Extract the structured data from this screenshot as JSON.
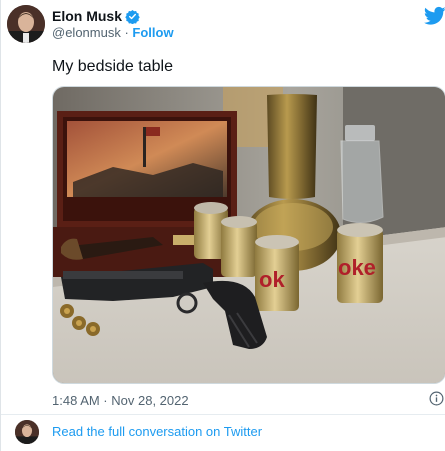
{
  "tweet": {
    "author": {
      "display_name": "Elon Musk",
      "handle": "@elonmusk",
      "separator": " · ",
      "follow_label": "Follow"
    },
    "text": "My bedside table",
    "timestamp": "1:48 AM · Nov 28, 2022"
  },
  "footer": {
    "link_text": "Read the full conversation on Twitter"
  },
  "icons": {
    "verified": "verified-badge-icon",
    "brand": "twitter-bird-icon",
    "info": "info-icon"
  },
  "colors": {
    "accent": "#1d9bf0",
    "text_primary": "#0f1419",
    "text_secondary": "#536471"
  }
}
